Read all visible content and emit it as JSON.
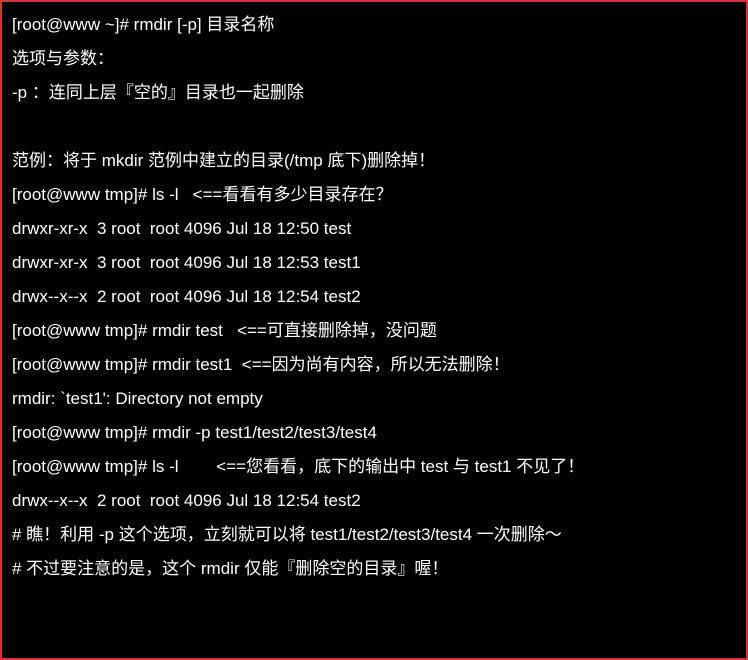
{
  "lines": [
    "[root@www ~]# rmdir [-p] 目录名称",
    "选项与参数：",
    "-p ：连同上层『空的』目录也一起删除",
    " ",
    "范例：将于 mkdir 范例中建立的目录(/tmp 底下)删除掉！",
    "[root@www tmp]# ls -l   <==看看有多少目录存在？",
    "drwxr-xr-x  3 root  root 4096 Jul 18 12:50 test",
    "drwxr-xr-x  3 root  root 4096 Jul 18 12:53 test1",
    "drwx--x--x  2 root  root 4096 Jul 18 12:54 test2",
    "[root@www tmp]# rmdir test   <==可直接删除掉，没问题",
    "[root@www tmp]# rmdir test1  <==因为尚有内容，所以无法删除！",
    "rmdir: `test1': Directory not empty",
    "[root@www tmp]# rmdir -p test1/test2/test3/test4",
    "[root@www tmp]# ls -l        <==您看看，底下的输出中 test 与 test1 不见了！",
    "drwx--x--x  2 root  root 4096 Jul 18 12:54 test2",
    "# 瞧！利用 -p 这个选项，立刻就可以将 test1/test2/test3/test4 一次删除～",
    "# 不过要注意的是，这个 rmdir 仅能『删除空的目录』喔！"
  ]
}
